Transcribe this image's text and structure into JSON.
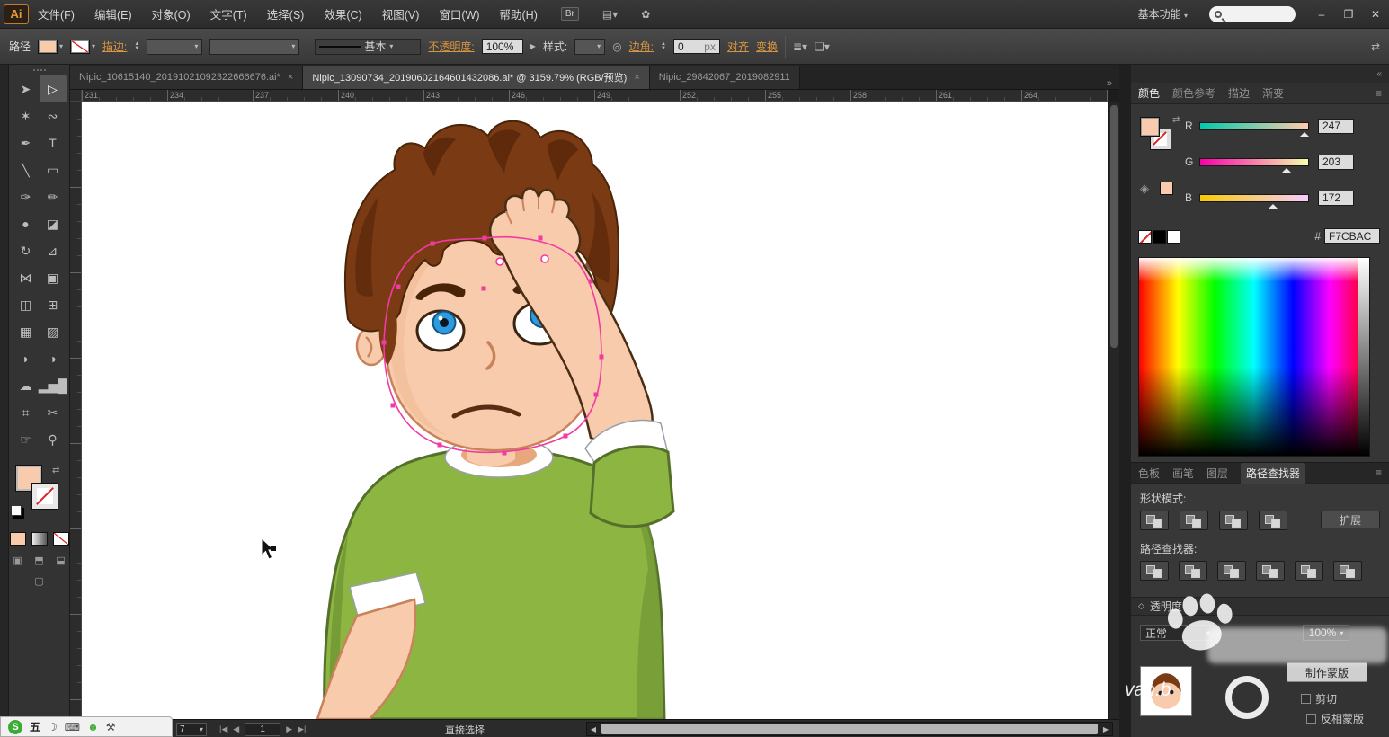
{
  "app": {
    "badge": "Ai",
    "bridge_badge": "Br",
    "workspace": "基本功能",
    "window_controls": {
      "minimize": "–",
      "restore": "❐",
      "close": "✕"
    }
  },
  "menu": {
    "items": [
      "文件(F)",
      "编辑(E)",
      "对象(O)",
      "文字(T)",
      "选择(S)",
      "效果(C)",
      "视图(V)",
      "窗口(W)",
      "帮助(H)"
    ]
  },
  "control_bar": {
    "selection_type": "路径",
    "stroke_label": "描边:",
    "brush_definition": "基本",
    "opacity_label": "不透明度:",
    "opacity_value": "100%",
    "style_label": "样式:",
    "corner_label": "边角:",
    "corner_value": "0",
    "corner_unit": "px",
    "align_link": "对齐",
    "transform_link": "变换"
  },
  "doc_tabs": {
    "tabs": [
      {
        "title": "Nipic_10615140_20191021092322666676.ai*",
        "close": "×"
      },
      {
        "title": "Nipic_13090734_20190602164601432086.ai* @ 3159.79% (RGB/预览)",
        "close": "×"
      },
      {
        "title": "Nipic_29842067_2019082911",
        "close": ""
      }
    ],
    "overflow": "»"
  },
  "ruler": {
    "h_labels": [
      "231",
      "234",
      "237",
      "240",
      "243",
      "246",
      "249",
      "252",
      "255",
      "258",
      "261",
      "264"
    ]
  },
  "toolbar": {
    "tools": [
      {
        "name": "selection-tool",
        "glyph": "➤"
      },
      {
        "name": "direct-selection-tool",
        "glyph": "▷"
      },
      {
        "name": "magic-wand-tool",
        "glyph": "✶"
      },
      {
        "name": "lasso-tool",
        "glyph": "∾"
      },
      {
        "name": "pen-tool",
        "glyph": "✒"
      },
      {
        "name": "type-tool",
        "glyph": "T"
      },
      {
        "name": "line-segment-tool",
        "glyph": "╲"
      },
      {
        "name": "rectangle-tool",
        "glyph": "▭"
      },
      {
        "name": "paintbrush-tool",
        "glyph": "✑"
      },
      {
        "name": "pencil-tool",
        "glyph": "✏"
      },
      {
        "name": "blob-brush-tool",
        "glyph": "●"
      },
      {
        "name": "eraser-tool",
        "glyph": "◪"
      },
      {
        "name": "rotate-tool",
        "glyph": "↻"
      },
      {
        "name": "scale-tool",
        "glyph": "⊿"
      },
      {
        "name": "width-tool",
        "glyph": "⋈"
      },
      {
        "name": "free-transform-tool",
        "glyph": "▣"
      },
      {
        "name": "shape-builder-tool",
        "glyph": "◫"
      },
      {
        "name": "perspective-grid-tool",
        "glyph": "⊞"
      },
      {
        "name": "mesh-tool",
        "glyph": "▦"
      },
      {
        "name": "gradient-tool",
        "glyph": "▨"
      },
      {
        "name": "eyedropper-tool",
        "glyph": "◗"
      },
      {
        "name": "blend-tool",
        "glyph": "◑"
      },
      {
        "name": "symbol-sprayer-tool",
        "glyph": "☁"
      },
      {
        "name": "column-graph-tool",
        "glyph": "▂▅█"
      },
      {
        "name": "artboard-tool",
        "glyph": "⌗"
      },
      {
        "name": "slice-tool",
        "glyph": "✂"
      },
      {
        "name": "hand-tool",
        "glyph": "☞"
      },
      {
        "name": "zoom-tool",
        "glyph": "⚲"
      }
    ]
  },
  "color_panel": {
    "tabs": [
      "颜色",
      "颜色参考",
      "描边",
      "渐变"
    ],
    "channels": [
      {
        "label": "R",
        "value": "247"
      },
      {
        "label": "G",
        "value": "203"
      },
      {
        "label": "B",
        "value": "172"
      }
    ],
    "hex_prefix": "#",
    "hex_value": "F7CBAC",
    "fill_color": "#F7CBAC"
  },
  "dock_tabs": {
    "tabs": [
      "色板",
      "画笔",
      "图层",
      "路径查找器"
    ]
  },
  "pathfinder": {
    "shape_modes_label": "形状模式:",
    "expand_button": "扩展",
    "pathfinder_label": "路径查找器:",
    "shape_mode_buttons": [
      {
        "name": "unite-button"
      },
      {
        "name": "minus-front-button"
      },
      {
        "name": "intersect-button"
      },
      {
        "name": "exclude-button"
      }
    ],
    "pathfinder_buttons": [
      {
        "name": "divide-button"
      },
      {
        "name": "trim-button"
      },
      {
        "name": "merge-button"
      },
      {
        "name": "crop-button"
      },
      {
        "name": "outline-button"
      },
      {
        "name": "minus-back-button"
      }
    ]
  },
  "transparency": {
    "title": "透明度",
    "blend_mode": "正常",
    "opacity_value": "100%",
    "make_mask": "制作蒙版",
    "clip": "剪切",
    "invert_mask": "反相蒙版"
  },
  "status_bar": {
    "zoom_value": "7",
    "artboard_value": "1",
    "tool_status": "直接选择"
  },
  "ime_bar": {
    "brand": "S",
    "mode": "五"
  },
  "watermark": {
    "partial_text": "van.b"
  },
  "colors": {
    "fill": "#F7CBAC",
    "accent_link": "#D79542",
    "shirt_green": "#8CB542",
    "selection_pink": "#F23AA2"
  }
}
